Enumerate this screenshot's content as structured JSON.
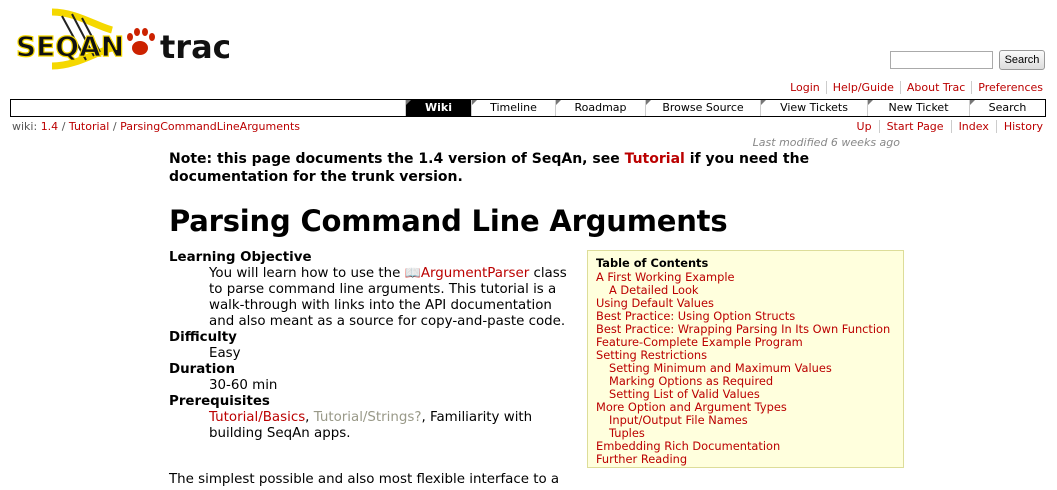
{
  "header": {
    "logo_text": "SEQAN trac",
    "search_button": "Search",
    "search_placeholder": ""
  },
  "metanav": [
    "Login",
    "Help/Guide",
    "About Trac",
    "Preferences"
  ],
  "mainnav": [
    {
      "label": "Wiki",
      "active": true
    },
    {
      "label": "Timeline",
      "active": false
    },
    {
      "label": "Roadmap",
      "active": false
    },
    {
      "label": "Browse Source",
      "active": false
    },
    {
      "label": "View Tickets",
      "active": false
    },
    {
      "label": "New Ticket",
      "active": false
    },
    {
      "label": "Search",
      "active": false
    }
  ],
  "pagepath": {
    "prefix": "wiki:",
    "parts": [
      "1.4",
      "Tutorial",
      "ParsingCommandLineArguments"
    ]
  },
  "ctxnav": [
    "Up",
    "Start Page",
    "Index",
    "History"
  ],
  "last_modified": "Last modified 6 weeks ago",
  "note": {
    "before": "Note: this page documents the 1.4 version of SeqAn, see ",
    "link": "Tutorial",
    "after": " if you need the documentation for the trunk version."
  },
  "title": "Parsing Command Line Arguments",
  "definitions": {
    "learning_objective_term": "Learning Objective",
    "learning_objective_before": "You will learn how to use the ",
    "learning_objective_link": "ArgumentParser",
    "learning_objective_after": " class to parse command line arguments. This tutorial is a walk-through with links into the API documentation and also meant as a source for copy-and-paste code.",
    "difficulty_term": "Difficulty",
    "difficulty_value": "Easy",
    "duration_term": "Duration",
    "duration_value": "30-60 min",
    "prerequisites_term": "Prerequisites",
    "prereq_link1": "Tutorial/Basics",
    "prereq_sep": ", ",
    "prereq_link2": "Tutorial/Strings?",
    "prereq_after": ", Familiarity with building SeqAn apps."
  },
  "paragraph": "The simplest possible and also most flexible interface to a",
  "toc": {
    "title": "Table of Contents",
    "items": [
      {
        "label": "A First Working Example",
        "level": 1
      },
      {
        "label": "A Detailed Look",
        "level": 2
      },
      {
        "label": "Using Default Values",
        "level": 1
      },
      {
        "label": "Best Practice: Using Option Structs",
        "level": 1
      },
      {
        "label": "Best Practice: Wrapping Parsing In Its Own Function",
        "level": 1
      },
      {
        "label": "Feature-Complete Example Program",
        "level": 1
      },
      {
        "label": "Setting Restrictions",
        "level": 1
      },
      {
        "label": "Setting Minimum and Maximum Values",
        "level": 2
      },
      {
        "label": "Marking Options as Required",
        "level": 2
      },
      {
        "label": "Setting List of Valid Values",
        "level": 2
      },
      {
        "label": "More Option and Argument Types",
        "level": 1
      },
      {
        "label": "Input/Output File Names",
        "level": 2
      },
      {
        "label": "Tuples",
        "level": 2
      },
      {
        "label": "Embedding Rich Documentation",
        "level": 1
      },
      {
        "label": "Further Reading",
        "level": 1
      }
    ]
  },
  "colors": {
    "link": "#bb0000",
    "toc_bg": "#ffffdd",
    "logo_yellow": "#f5d800",
    "logo_red": "#cc2200"
  }
}
